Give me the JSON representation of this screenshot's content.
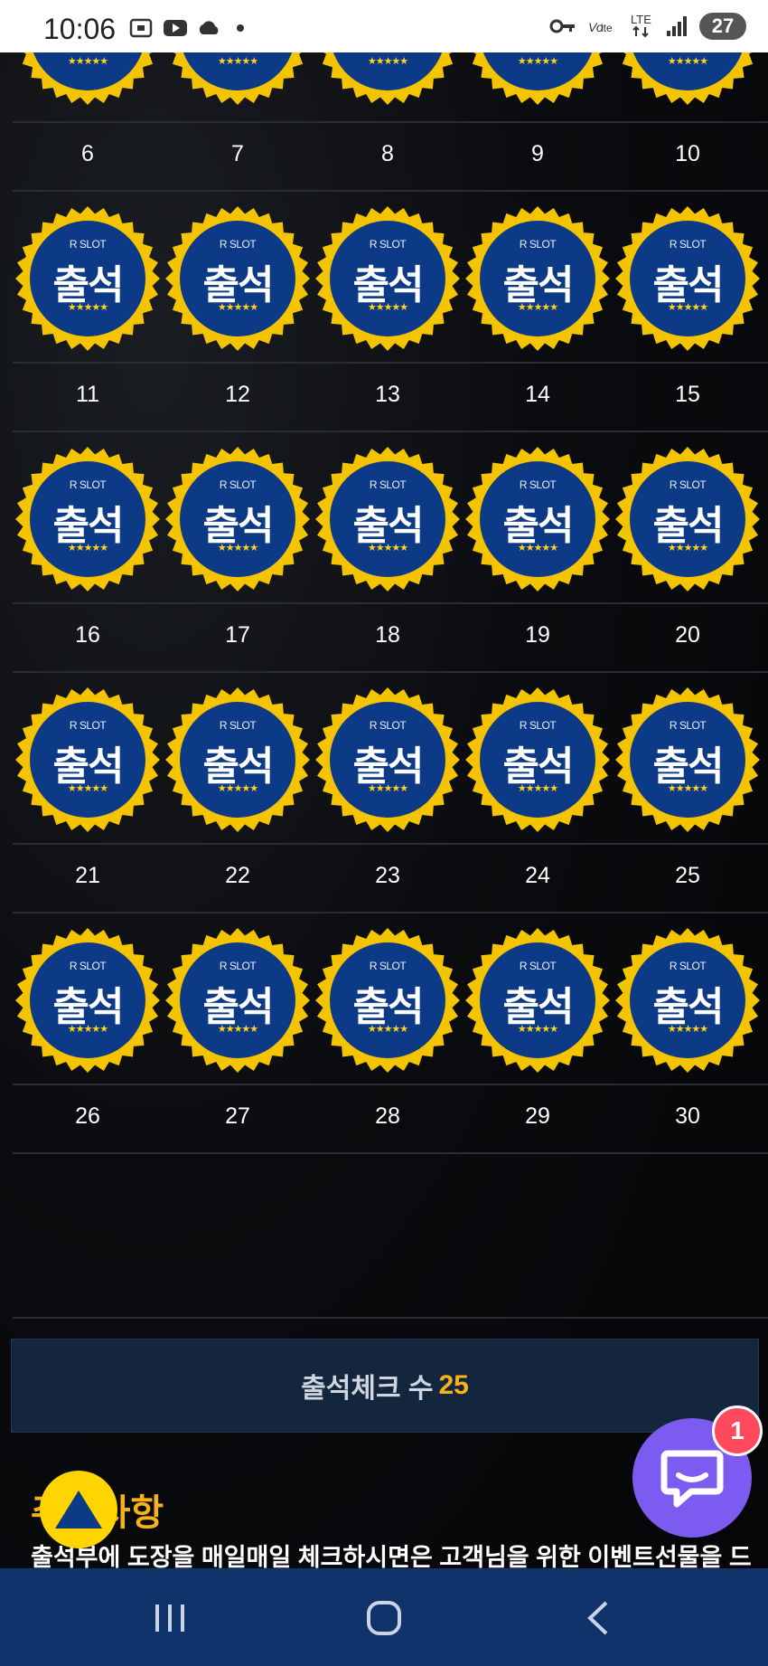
{
  "status_bar": {
    "time": "10:06",
    "battery": "27",
    "network": "LTE",
    "icons_left": [
      "screenshot-icon",
      "youtube-icon",
      "cloud-icon",
      "dot-icon"
    ],
    "icons_right": [
      "vpn-key-icon",
      "volte-icon",
      "lte-icon",
      "signal-icon",
      "battery-icon"
    ]
  },
  "badge": {
    "top_text": "R SLOT",
    "main_text": "출석",
    "stars": "★★★★★",
    "colors": {
      "ring": "#f5c400",
      "inner": "#0d3a86",
      "text": "#ffffff"
    }
  },
  "calendar": {
    "rows": [
      {
        "days": [
          "6",
          "7",
          "8",
          "9",
          "10"
        ]
      },
      {
        "days": [
          "11",
          "12",
          "13",
          "14",
          "15"
        ]
      },
      {
        "days": [
          "16",
          "17",
          "18",
          "19",
          "20"
        ]
      },
      {
        "days": [
          "21",
          "22",
          "23",
          "24",
          "25"
        ]
      },
      {
        "days": [
          "26",
          "27",
          "28",
          "29",
          "30"
        ]
      }
    ]
  },
  "summary": {
    "label": "출석체크 수",
    "count": "25",
    "count_color": "#f7b318"
  },
  "notice": {
    "title_visible": "주의사항",
    "body": "출석부에 도장을 매일매일 체크하시면은 고객님을 위한 이벤트선물을 드"
  },
  "chat": {
    "unread": "1",
    "color": "#7c5cf0"
  },
  "nav": {
    "buttons": [
      "recent-apps",
      "home",
      "back"
    ]
  }
}
